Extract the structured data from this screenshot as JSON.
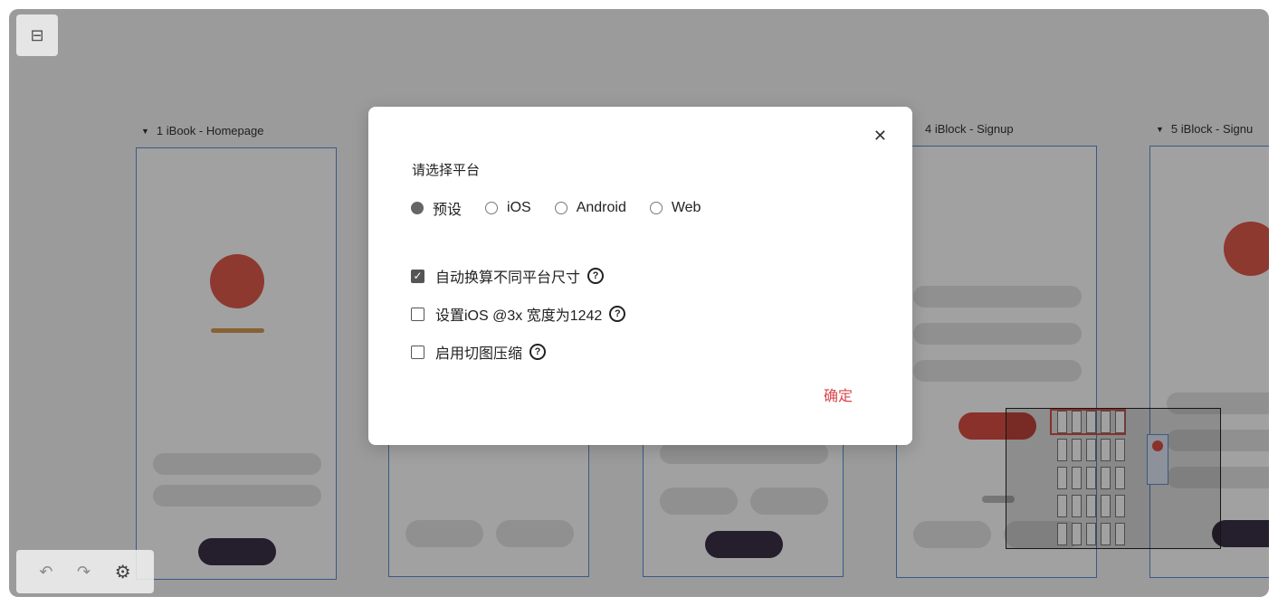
{
  "artboards": [
    {
      "index": "1",
      "title": "1 iBook - Homepage"
    },
    {
      "index": "4",
      "title": "4 iBlock - Signup"
    },
    {
      "index": "5",
      "title": "5 iBlock - Signu"
    }
  ],
  "icons": {
    "layers": "layers-icon",
    "undo": "undo-icon",
    "redo": "redo-icon",
    "settings": "gear-icon",
    "close": "close-icon",
    "help": "question-circle-icon"
  },
  "dialog": {
    "title": "请选择平台",
    "platform_options": [
      {
        "label": "预设",
        "selected": true
      },
      {
        "label": "iOS",
        "selected": false
      },
      {
        "label": "Android",
        "selected": false
      },
      {
        "label": "Web",
        "selected": false
      }
    ],
    "options": [
      {
        "label": "自动换算不同平台尺寸",
        "checked": true
      },
      {
        "label": "设置iOS @3x 宽度为1242",
        "checked": false
      },
      {
        "label": "启用切图压缩",
        "checked": false
      }
    ],
    "confirm_label": "确定"
  },
  "colors": {
    "accent_red": "#d94e43",
    "confirm_text": "#d9464a",
    "artboard_border": "#5b8fd6",
    "dark_button": "#3b3047"
  }
}
